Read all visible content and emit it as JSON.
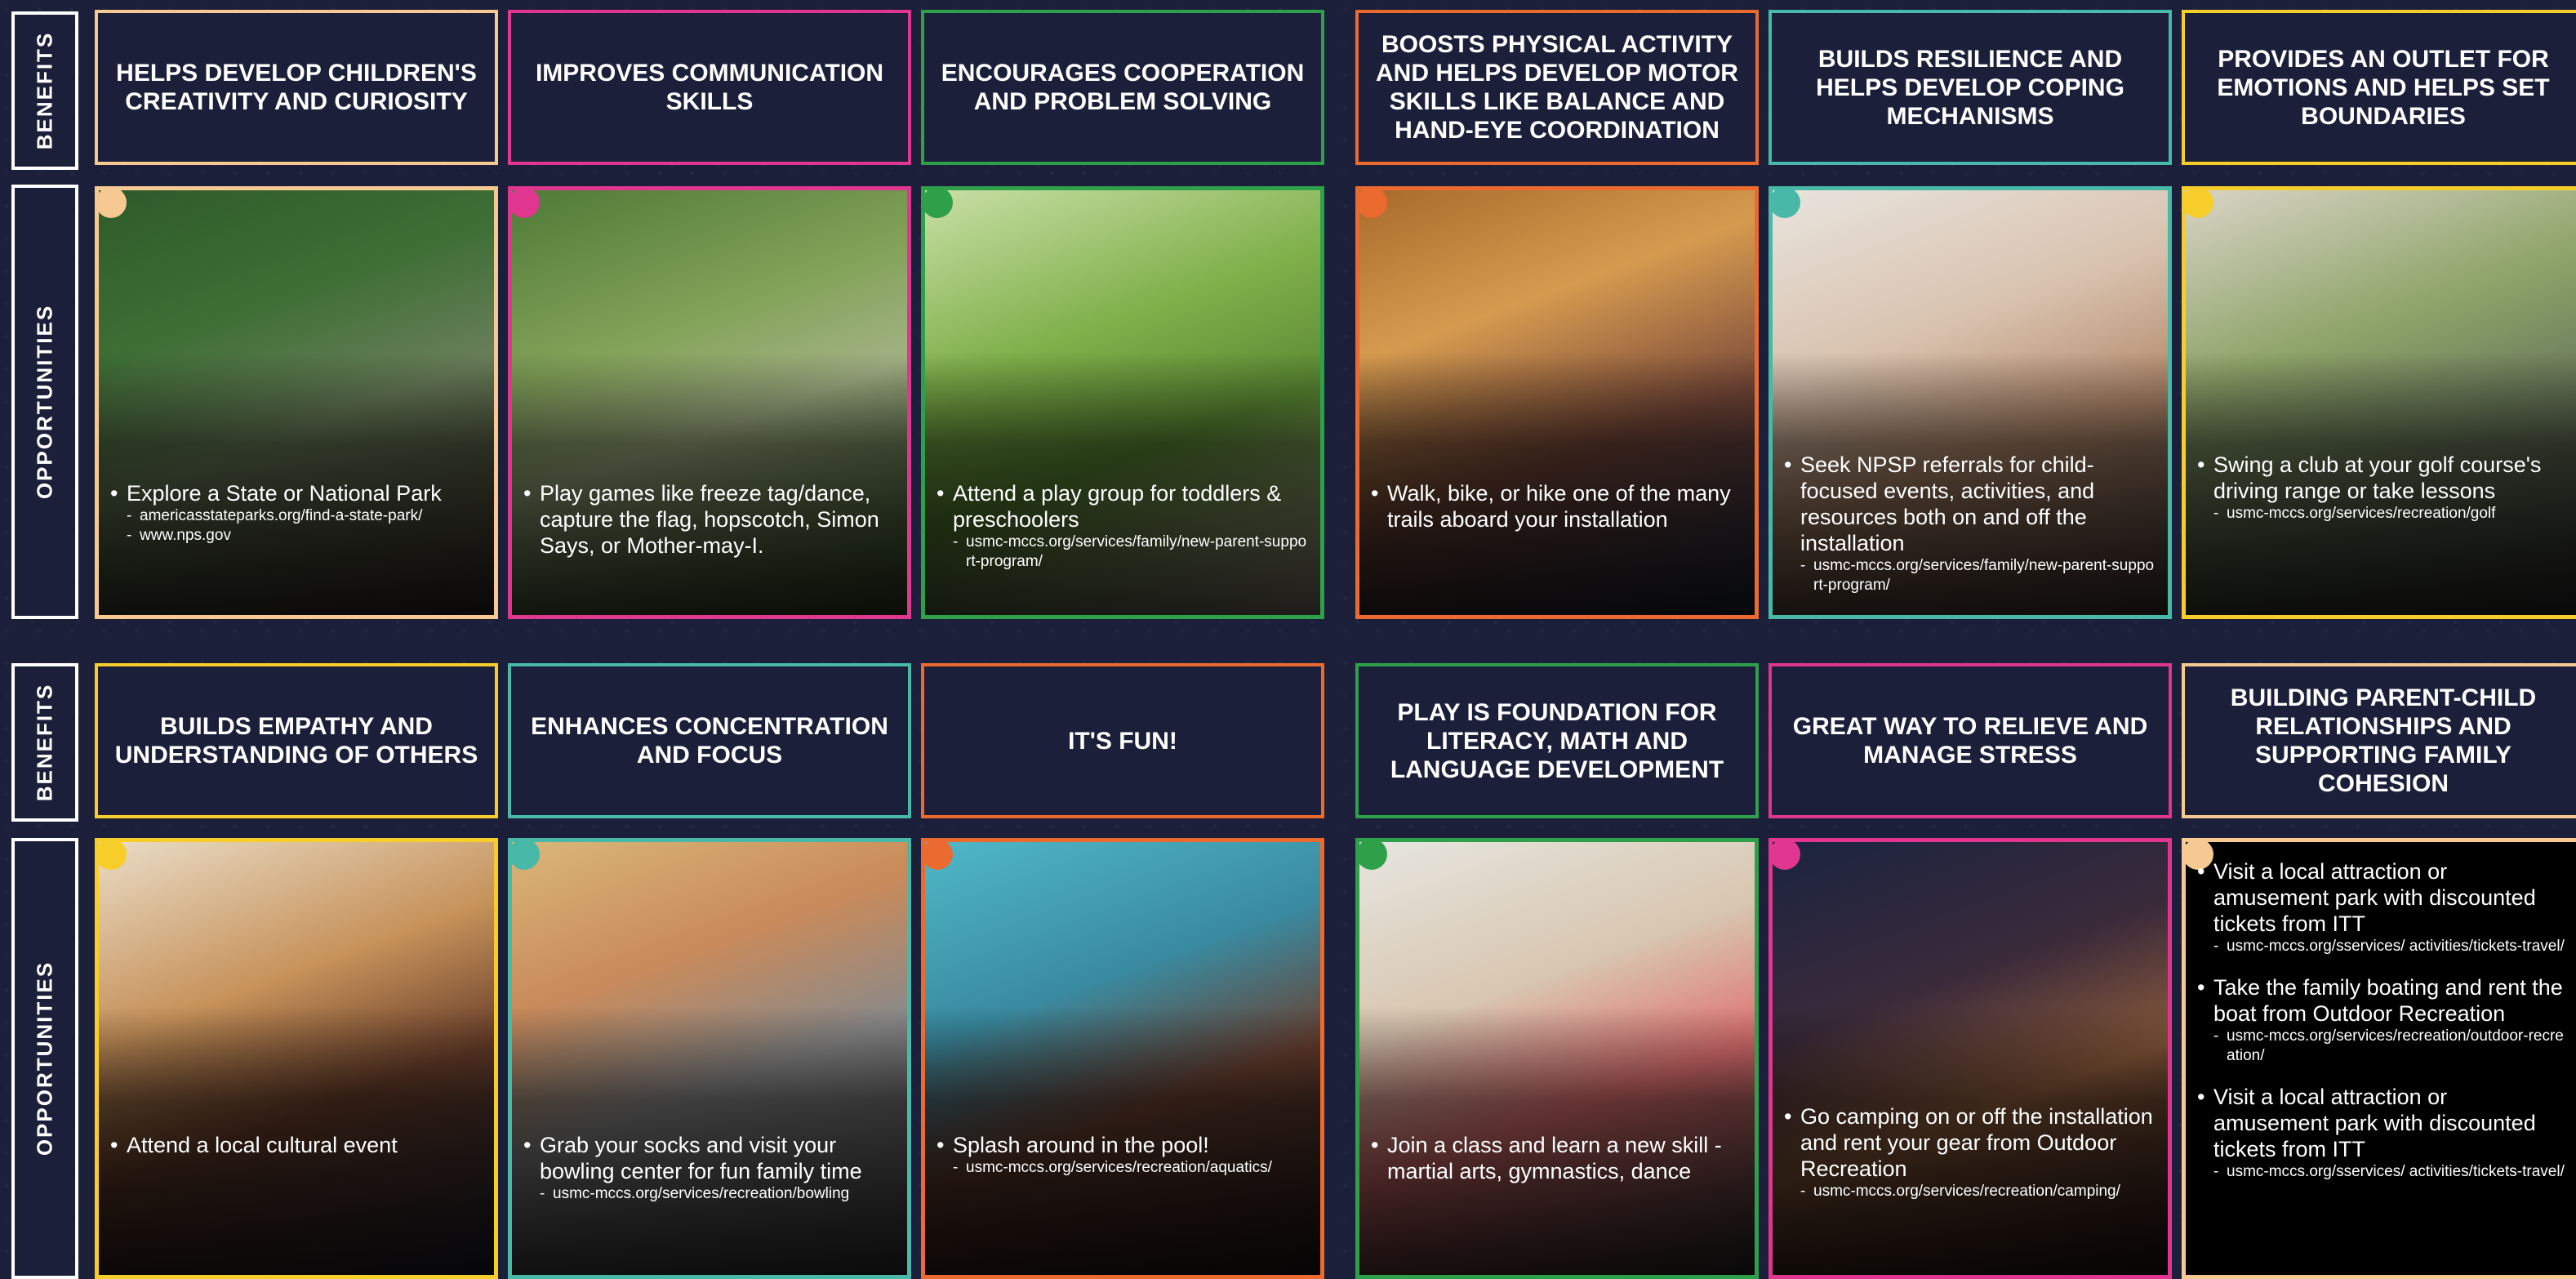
{
  "labels": {
    "benefits": "BENEFITS",
    "opportunities": "OPPORTUNITIES"
  },
  "colors": {
    "background": "#1b1f3a",
    "peach": "#f6c992",
    "magenta": "#e0368f",
    "green": "#2fa04a",
    "orange": "#ea6a2f",
    "teal": "#48b8a8",
    "yellow": "#f7cd2a"
  },
  "row1": {
    "benefits": [
      "HELPS DEVELOP CHILDREN'S CREATIVITY AND CURIOSITY",
      "IMPROVES COMMUNICATION SKILLS",
      "ENCOURAGES COOPERATION AND PROBLEM SOLVING",
      "BOOSTS PHYSICAL ACTIVITY AND HELPS DEVELOP MOTOR SKILLS LIKE BALANCE AND HAND-EYE COORDINATION",
      "BUILDS RESILIENCE AND HELPS DEVELOP COPING MECHANISMS",
      "PROVIDES AN OUTLET FOR EMOTIONS AND HELPS SET BOUNDARIES"
    ],
    "opportunities": [
      {
        "text": "Explore a State or National Park",
        "links": [
          "americasstateparks.org/find-a-state-park/",
          "www.nps.gov"
        ]
      },
      {
        "text": "Play games like freeze tag/dance, capture the flag, hopscotch, Simon Says, or Mother-may-I.",
        "links": []
      },
      {
        "text": "Attend a play group for toddlers & preschoolers",
        "links": [
          "usmc-mccs.org/services/family/new-parent-support-program/"
        ]
      },
      {
        "text": "Walk, bike, or hike one of the many trails aboard your installation",
        "links": []
      },
      {
        "text": "Seek NPSP referrals for child-focused events, activities, and resources both on and off the installation",
        "links": [
          "usmc-mccs.org/services/family/new-parent-support-program/"
        ]
      },
      {
        "text": "Swing a club at your golf course's driving range or take lessons",
        "links": [
          "usmc-mccs.org/services/recreation/golf"
        ]
      }
    ]
  },
  "row2": {
    "benefits": [
      "BUILDS EMPATHY AND UNDERSTANDING OF OTHERS",
      "ENHANCES CONCENTRATION AND FOCUS",
      "IT'S FUN!",
      "PLAY IS FOUNDATION FOR LITERACY, MATH AND LANGUAGE DEVELOPMENT",
      "GREAT WAY TO RELIEVE AND MANAGE STRESS",
      "BUILDING PARENT-CHILD RELATIONSHIPS AND SUPPORTING FAMILY COHESION"
    ],
    "opportunities": [
      {
        "text": "Attend a local cultural event",
        "links": []
      },
      {
        "text": "Grab your socks and visit your bowling center for fun family time",
        "links": [
          "usmc-mccs.org/services/recreation/bowling"
        ]
      },
      {
        "text": "Splash around in the pool!",
        "links": [
          "usmc-mccs.org/services/recreation/aquatics/"
        ]
      },
      {
        "text": "Join a class and learn a new skill - martial arts, gymnastics, dance",
        "links": []
      },
      {
        "text": "Go camping on or off the installation and rent your gear from Outdoor Recreation",
        "links": [
          "usmc-mccs.org/services/recreation/camping/"
        ]
      }
    ],
    "last_card": [
      {
        "text": "Visit a local attraction or amusement park with discounted tickets from ITT",
        "links": [
          "usmc-mccs.org/sservices/ activities/tickets-travel/"
        ]
      },
      {
        "text": "Take the family boating and rent the boat from Outdoor Recreation",
        "links": [
          "usmc-mccs.org/services/recreation/outdoor-recreation/"
        ]
      },
      {
        "text": "Visit a local attraction or amusement park with discounted tickets from ITT",
        "links": [
          "usmc-mccs.org/sservices/ activities/tickets-travel/"
        ]
      }
    ]
  }
}
